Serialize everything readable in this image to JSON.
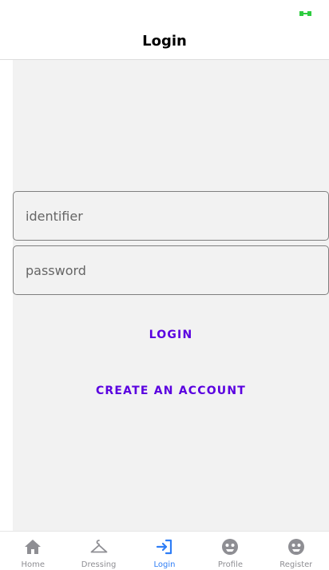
{
  "header": {
    "title": "Login"
  },
  "form": {
    "identifier_placeholder": "identifier",
    "password_placeholder": "password",
    "login_label": "LOGIN",
    "create_account_label": "CREATE AN ACCOUNT"
  },
  "tabs": [
    {
      "label": "Home",
      "icon": "home-icon",
      "active": false
    },
    {
      "label": "Dressing",
      "icon": "hanger-icon",
      "active": false
    },
    {
      "label": "Login",
      "icon": "login-icon",
      "active": true
    },
    {
      "label": "Profile",
      "icon": "profile-icon",
      "active": false
    },
    {
      "label": "Register",
      "icon": "register-icon",
      "active": false
    }
  ],
  "colors": {
    "accent": "#5a00e0",
    "tab_active": "#2f7ef6",
    "tab_inactive": "#8e8e93",
    "battery": "#2ecc40"
  }
}
